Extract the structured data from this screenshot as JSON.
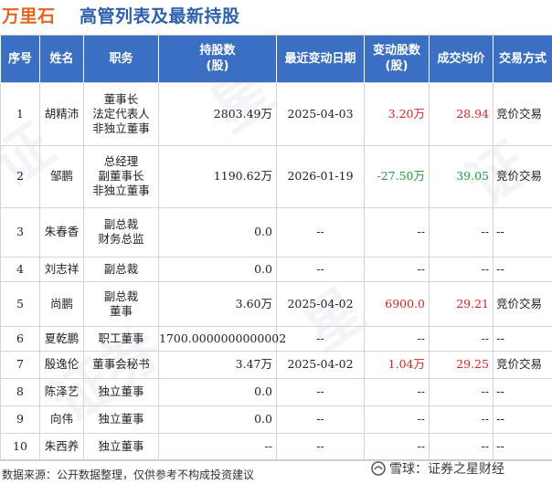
{
  "title": {
    "company": "万里石",
    "text": "高管列表及最新持股"
  },
  "headers": [
    "序号",
    "姓名",
    "职务",
    "持股数\n(股)",
    "最近变动日期",
    "变动股数\n(股)",
    "成交均价",
    "交易方式"
  ],
  "rows": [
    {
      "no": "1",
      "name": "胡精沛",
      "roles": [
        "董事长",
        "法定代表人",
        "非独立董事"
      ],
      "shares": "2803.49万",
      "date": "2025-04-03",
      "change": "3.20万",
      "change_color": "red",
      "price": "28.94",
      "price_color": "red",
      "method": "竞价交易"
    },
    {
      "no": "2",
      "name": "邹鹏",
      "roles": [
        "总经理",
        "副董事长",
        "非独立董事"
      ],
      "shares": "1190.62万",
      "date": "2026-01-19",
      "change": "-27.50万",
      "change_color": "green",
      "price": "39.05",
      "price_color": "green",
      "method": "竞价交易"
    },
    {
      "no": "3",
      "name": "朱春香",
      "roles": [
        "副总裁",
        "财务总监"
      ],
      "shares": "0.0",
      "date": "--",
      "change": "--",
      "change_color": "",
      "price": "--",
      "price_color": "",
      "method": "--"
    },
    {
      "no": "4",
      "name": "刘志祥",
      "roles": [
        "副总裁"
      ],
      "shares": "0.0",
      "date": "--",
      "change": "--",
      "change_color": "",
      "price": "--",
      "price_color": "",
      "method": "--"
    },
    {
      "no": "5",
      "name": "尚鹏",
      "roles": [
        "副总裁",
        "董事"
      ],
      "shares": "3.60万",
      "date": "2025-04-02",
      "change": "6900.0",
      "change_color": "red",
      "price": "29.21",
      "price_color": "red",
      "method": "竞价交易"
    },
    {
      "no": "6",
      "name": "夏乾鹏",
      "roles": [
        "职工董事"
      ],
      "shares": "1700.0000000000002",
      "date": "--",
      "change": "--",
      "change_color": "",
      "price": "--",
      "price_color": "",
      "method": "--"
    },
    {
      "no": "7",
      "name": "殷逸伦",
      "roles": [
        "董事会秘书"
      ],
      "shares": "3.47万",
      "date": "2025-04-02",
      "change": "1.04万",
      "change_color": "red",
      "price": "29.25",
      "price_color": "red",
      "method": "竞价交易"
    },
    {
      "no": "8",
      "name": "陈泽艺",
      "roles": [
        "独立董事"
      ],
      "shares": "0.0",
      "date": "--",
      "change": "--",
      "change_color": "",
      "price": "--",
      "price_color": "",
      "method": "--"
    },
    {
      "no": "9",
      "name": "向伟",
      "roles": [
        "独立董事"
      ],
      "shares": "0.0",
      "date": "--",
      "change": "--",
      "change_color": "",
      "price": "--",
      "price_color": "",
      "method": "--"
    },
    {
      "no": "10",
      "name": "朱西养",
      "roles": [
        "独立董事"
      ],
      "shares": "--",
      "date": "--",
      "change": "--",
      "change_color": "",
      "price": "--",
      "price_color": "",
      "method": "--"
    }
  ],
  "footer": "数据来源：公开数据整理，仅供参考不构成投资建议",
  "brand": {
    "icon": "snowball-icon",
    "text": "雪球：证券之星财经"
  },
  "colors": {
    "header_bg": "#3a6fc4",
    "company": "#e8641e",
    "title": "#2c5fae",
    "positive": "#e02020",
    "negative": "#1f9a3a"
  }
}
